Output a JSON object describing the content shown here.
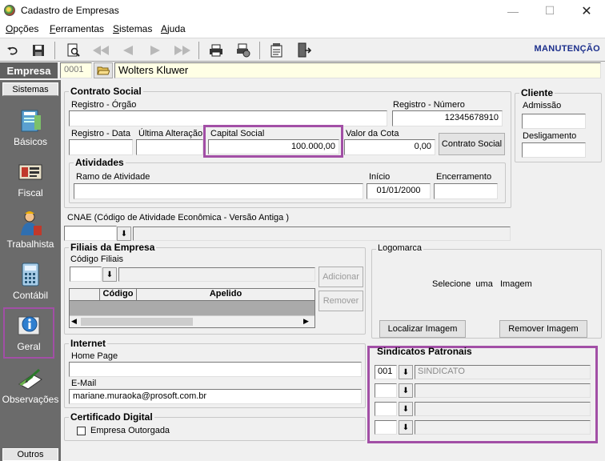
{
  "window": {
    "title": "Cadastro de Empresas"
  },
  "menu": [
    {
      "label": "Opções",
      "u": "O",
      "rest": "pções"
    },
    {
      "label": "Ferramentas",
      "u": "F",
      "rest": "erramentas"
    },
    {
      "label": "Sistemas",
      "u": "S",
      "rest": "istemas"
    },
    {
      "label": "Ajuda",
      "u": "A",
      "rest": "juda"
    }
  ],
  "toolbar": {
    "mode_label": "MANUTENÇÃO"
  },
  "empresa": {
    "label": "Empresa",
    "code": "0001",
    "name": "Wolters Kluwer"
  },
  "sidebar": {
    "tab_top": "Sistemas",
    "tab_bottom": "Outros",
    "items": [
      {
        "label": "Básicos",
        "icon": "book-icon"
      },
      {
        "label": "Fiscal",
        "icon": "fiscal-icon"
      },
      {
        "label": "Trabalhista",
        "icon": "worker-icon"
      },
      {
        "label": "Contábil",
        "icon": "calculator-icon"
      },
      {
        "label": "Geral",
        "icon": "info-icon",
        "selected": true
      },
      {
        "label": "Observações",
        "icon": "notepad-icon"
      }
    ]
  },
  "contrato": {
    "title": "Contrato Social",
    "registro_orgao_label": "Registro - Órgão",
    "registro_orgao": "",
    "registro_numero_label": "Registro - Número",
    "registro_numero": "12345678910",
    "registro_data_label": "Registro - Data",
    "registro_data": "",
    "ultima_alteracao_label": "Última Alteração",
    "ultima_alteracao": "",
    "capital_social_label": "Capital Social",
    "capital_social": "100.000,00",
    "valor_cota_label": "Valor da Cota",
    "valor_cota": "0,00",
    "contrato_button": "Contrato Social"
  },
  "atividades": {
    "title": "Atividades",
    "ramo_label": "Ramo de Atividade",
    "ramo": "",
    "inicio_label": "Início",
    "inicio": "01/01/2000",
    "encerramento_label": "Encerramento",
    "encerramento": ""
  },
  "cliente": {
    "title": "Cliente",
    "admissao_label": "Admissão",
    "admissao": "",
    "desligamento_label": "Desligamento",
    "desligamento": ""
  },
  "cnae": {
    "label": "CNAE (Código de Atividade Econômica - Versão Antiga )",
    "value": ""
  },
  "filiais": {
    "title": "Filiais da Empresa",
    "codigo_label": "Código Filiais",
    "codigo": "",
    "adicionar": "Adicionar",
    "remover": "Remover",
    "columns": [
      "Código",
      "Apelido"
    ]
  },
  "logomarca": {
    "title": "Logomarca",
    "placeholder": "Selecione  uma   Imagem",
    "localizar": "Localizar Imagem",
    "remover": "Remover Imagem"
  },
  "internet": {
    "title": "Internet",
    "home_label": "Home Page",
    "home": "",
    "email_label": "E-Mail",
    "email": "mariane.muraoka@prosoft.com.br"
  },
  "certificado": {
    "title": "Certificado Digital",
    "outorgada_label": "Empresa Outorgada",
    "outorgada": false
  },
  "sindicatos": {
    "title": "Sindicatos Patronais",
    "rows": [
      {
        "code": "001",
        "name": "SINDICATO"
      },
      {
        "code": "",
        "name": ""
      },
      {
        "code": "",
        "name": ""
      },
      {
        "code": "",
        "name": ""
      }
    ]
  }
}
